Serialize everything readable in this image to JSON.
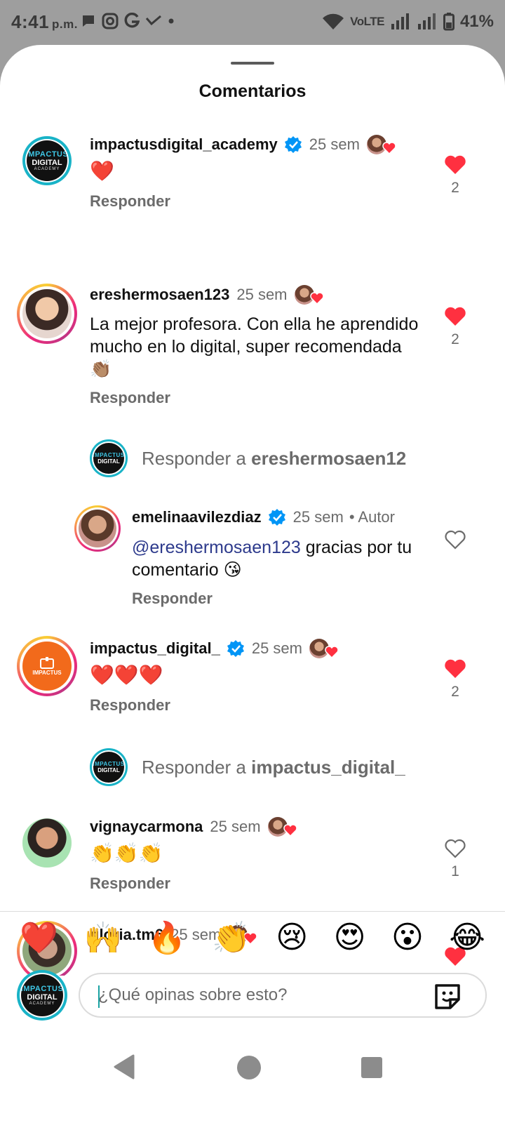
{
  "status_bar": {
    "time": "4:41",
    "ampm": "p.m.",
    "network": "VoLTE",
    "battery": "41%"
  },
  "sheet": {
    "title": "Comentarios"
  },
  "comments": [
    {
      "username": "impactusdigital_academy",
      "verified": true,
      "time": "25 sem",
      "text": "❤️",
      "reply_label": "Responder",
      "liked": true,
      "like_count": "2"
    },
    {
      "username": "ereshermosaen123",
      "verified": false,
      "time": "25 sem",
      "text": "La mejor profesora. Con ella he aprendido mucho en lo digital, super recomendada 👏🏽",
      "reply_label": "Responder",
      "liked": true,
      "like_count": "2"
    },
    {
      "username": "emelinaavilezdiaz",
      "verified": true,
      "time": "25 sem",
      "author_label": "• Autor",
      "mention": "@ereshermosaen123",
      "text": " gracias por tu comentario 😘",
      "reply_label": "Responder",
      "liked": false,
      "like_count": ""
    },
    {
      "username": "impactus_digital_",
      "verified": true,
      "time": "25 sem",
      "text": "❤️❤️❤️",
      "reply_label": "Responder",
      "liked": true,
      "like_count": "2"
    },
    {
      "username": "vignaycarmona",
      "verified": false,
      "time": "25 sem",
      "text": "👏👏👏",
      "reply_label": "Responder",
      "liked": false,
      "like_count": "1"
    },
    {
      "username": "gloria.tm6",
      "verified": false,
      "time": "25 sem",
      "liked": true
    }
  ],
  "reply_prompts": [
    {
      "prefix": "Responder a ",
      "target": "ereshermosaen12"
    },
    {
      "prefix": "Responder a ",
      "target": "impactus_digital_"
    }
  ],
  "avatar_logo": {
    "line1": "IMPACTUS",
    "line2": "DIGITAL",
    "line3": "ACADEMY",
    "orange_label": "IMPACTUS"
  },
  "quick_emojis": [
    "❤️",
    "🙌",
    "🔥",
    "👏",
    "😢",
    "😍",
    "😮",
    "😂"
  ],
  "composer": {
    "placeholder": "¿Qué opinas sobre esto?"
  },
  "colors": {
    "like_red": "#ff3040",
    "verified_blue": "#0095f6",
    "muted_text": "#6b6b6b",
    "mention": "#2d3a8c"
  }
}
